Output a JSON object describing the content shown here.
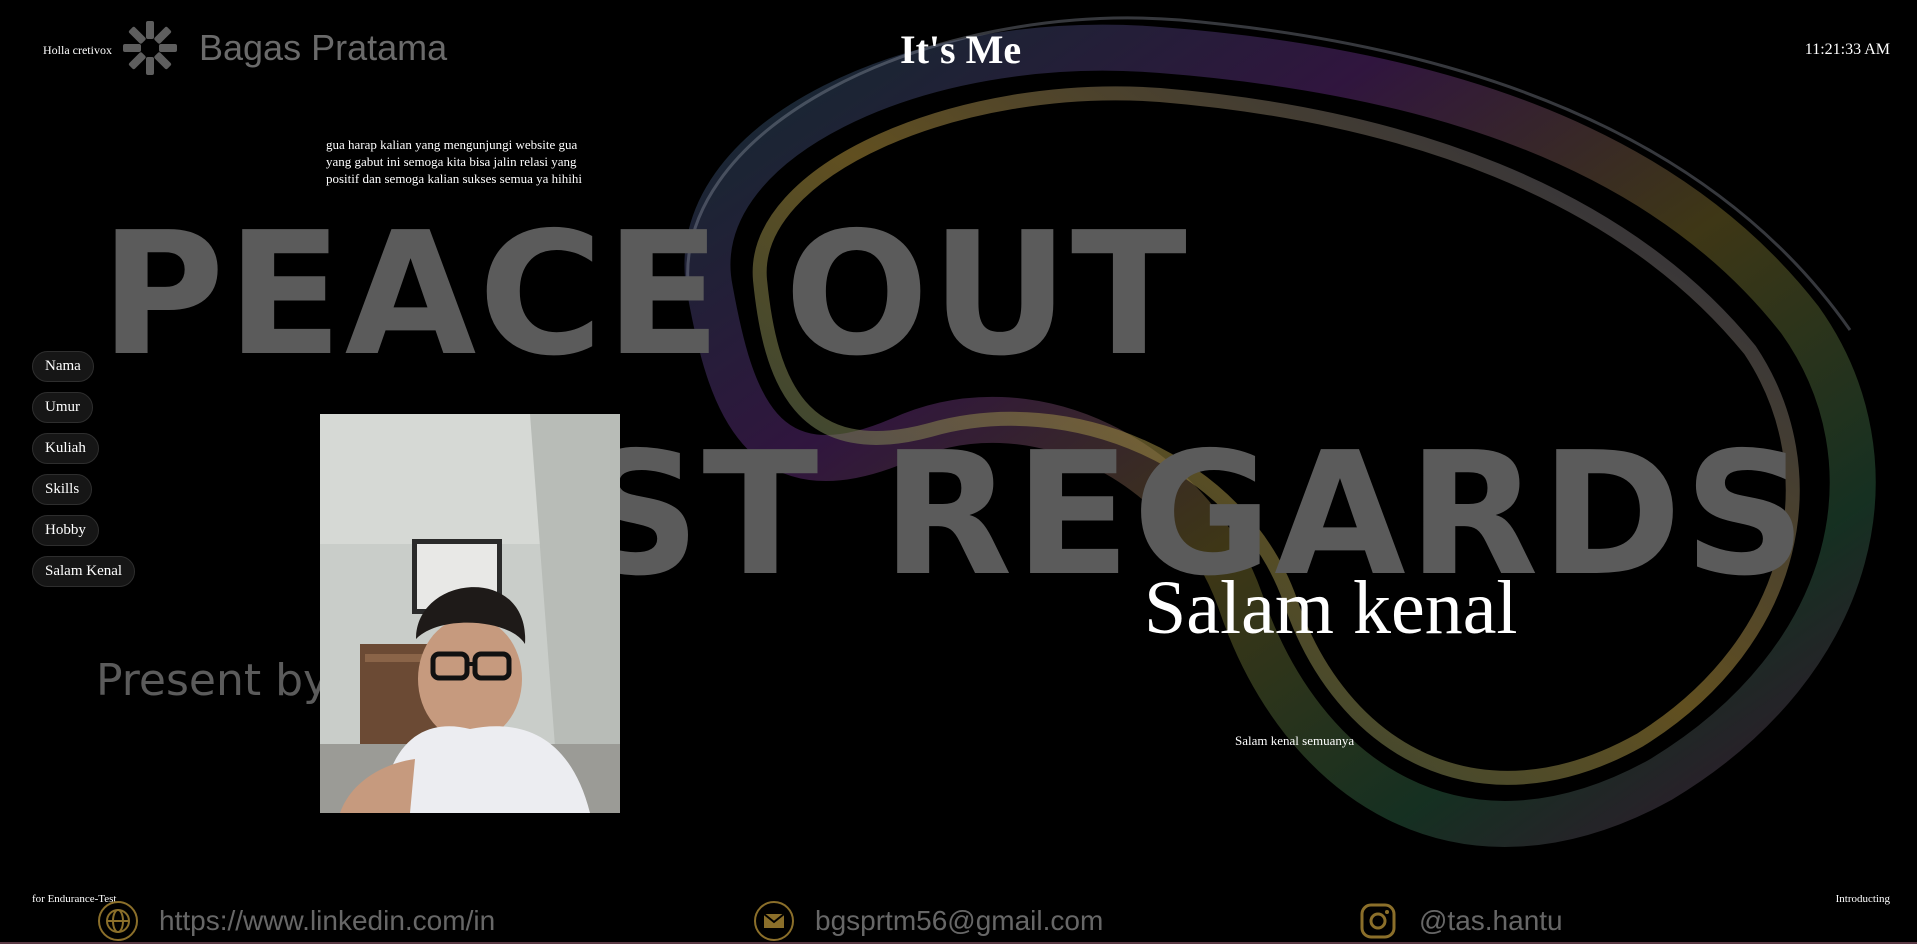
{
  "header": {
    "greeting": "Holla cretivox",
    "brand_name": "Bagas Pratama",
    "page_title": "It's Me",
    "clock": "11:21:33 AM"
  },
  "intro_text": "gua harap kalian yang mengunjungi website gua yang gabut ini semoga kita bisa jalin relasi yang positif dan semoga kalian sukses semua ya hihihi",
  "hero": {
    "line1": "PEACE OUT",
    "line2": "ST REGARDS",
    "present_by": "Present by"
  },
  "nav": {
    "items": [
      {
        "label": "Nama"
      },
      {
        "label": "Umur"
      },
      {
        "label": "Kuliah"
      },
      {
        "label": "Skills"
      },
      {
        "label": "Hobby"
      },
      {
        "label": "Salam Kenal"
      }
    ]
  },
  "section": {
    "title": "Salam kenal",
    "subtitle": "Salam kenal semuanya"
  },
  "footer": {
    "left": "for Endurance-Test",
    "right": "Introducting"
  },
  "contacts": [
    {
      "icon": "globe-icon",
      "text": "https://www.linkedin.com/in"
    },
    {
      "icon": "mail-icon",
      "text": "bgsprtm56@gmail.com"
    },
    {
      "icon": "instagram-icon",
      "text": "@tas.hantu"
    }
  ],
  "colors": {
    "background": "#000000",
    "hero_text": "#5b5b5b",
    "accent_gold": "#8b6f2a",
    "text": "#ffffff"
  }
}
